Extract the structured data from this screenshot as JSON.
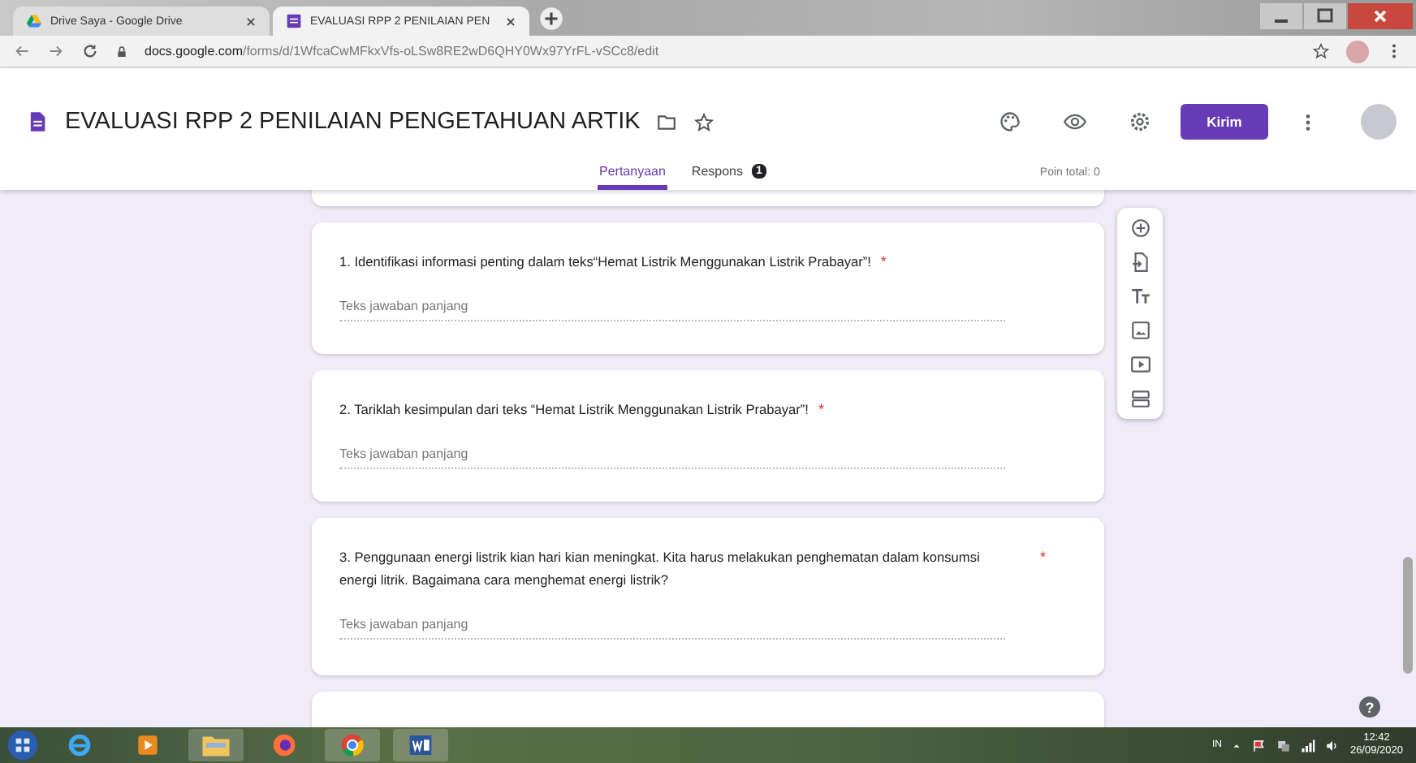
{
  "browser_tabs": [
    {
      "title": "Drive Saya - Google Drive",
      "kind": "drive",
      "selected": false
    },
    {
      "title": "EVALUASI RPP 2 PENILAIAN PEN",
      "kind": "forms",
      "selected": true
    }
  ],
  "address": {
    "host": "docs.google.com",
    "path": "/forms/d/1WfcaCwMFkxVfs-oLSw8RE2wD6QHY0Wx97YrFL-vSCc8/edit"
  },
  "form_header": {
    "title": "EVALUASI RPP 2 PENILAIAN PENGETAHUAN ARTIK",
    "send_button": "Kirim",
    "points": "Poin total: 0"
  },
  "form_tabs": [
    {
      "label": "Pertanyaan",
      "selected": true
    },
    {
      "label": "Respons",
      "badge": "1",
      "selected": false
    }
  ],
  "questions": [
    {
      "text": "1.   Identifikasi informasi penting dalam teks“Hemat Listrik Menggunakan Listrik Prabayar”!",
      "required_mark": "*",
      "placeholder": "Teks jawaban panjang"
    },
    {
      "text": "2.  Tariklah kesimpulan dari teks “Hemat Listrik Menggunakan Listrik Prabayar”!",
      "required_mark": "*",
      "placeholder": "Teks jawaban panjang"
    },
    {
      "text": "3.   Penggunaan energi listrik kian hari kian meningkat. Kita harus melakukan penghematan dalam konsumsi energi litrik. Bagaimana cara menghemat energi listrik?",
      "required_mark": "*",
      "placeholder": "Teks jawaban panjang"
    }
  ],
  "help": "?",
  "tray": {
    "language": "IN",
    "time": "12:42",
    "date": "26/09/2020"
  }
}
